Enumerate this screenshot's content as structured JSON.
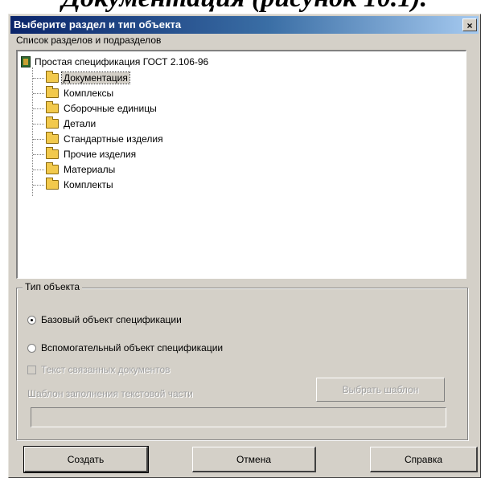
{
  "caption": "Документация (рисунок 10.1).",
  "dialog": {
    "title": "Выберите раздел и тип объекта",
    "close_glyph": "×"
  },
  "tree": {
    "label": "Список разделов и подразделов",
    "root": "Простая спецификация ГОСТ 2.106-96",
    "items": [
      {
        "label": "Документация",
        "selected": true
      },
      {
        "label": "Комплексы"
      },
      {
        "label": "Сборочные единицы"
      },
      {
        "label": "Детали"
      },
      {
        "label": "Стандартные изделия"
      },
      {
        "label": "Прочие изделия"
      },
      {
        "label": "Материалы"
      },
      {
        "label": "Комплекты"
      }
    ]
  },
  "object_type": {
    "title": "Тип объекта",
    "base_label": "Базовый объект спецификации",
    "aux_label": "Вспомогательный объект спецификации",
    "selected": "base",
    "text_checkbox_label": "Текст связанных документов",
    "template_label": "Шаблон заполнения текстовой части",
    "choose_template": "Выбрать шаблон",
    "template_value": ""
  },
  "buttons": {
    "create": "Создать",
    "cancel": "Отмена",
    "help": "Справка"
  }
}
